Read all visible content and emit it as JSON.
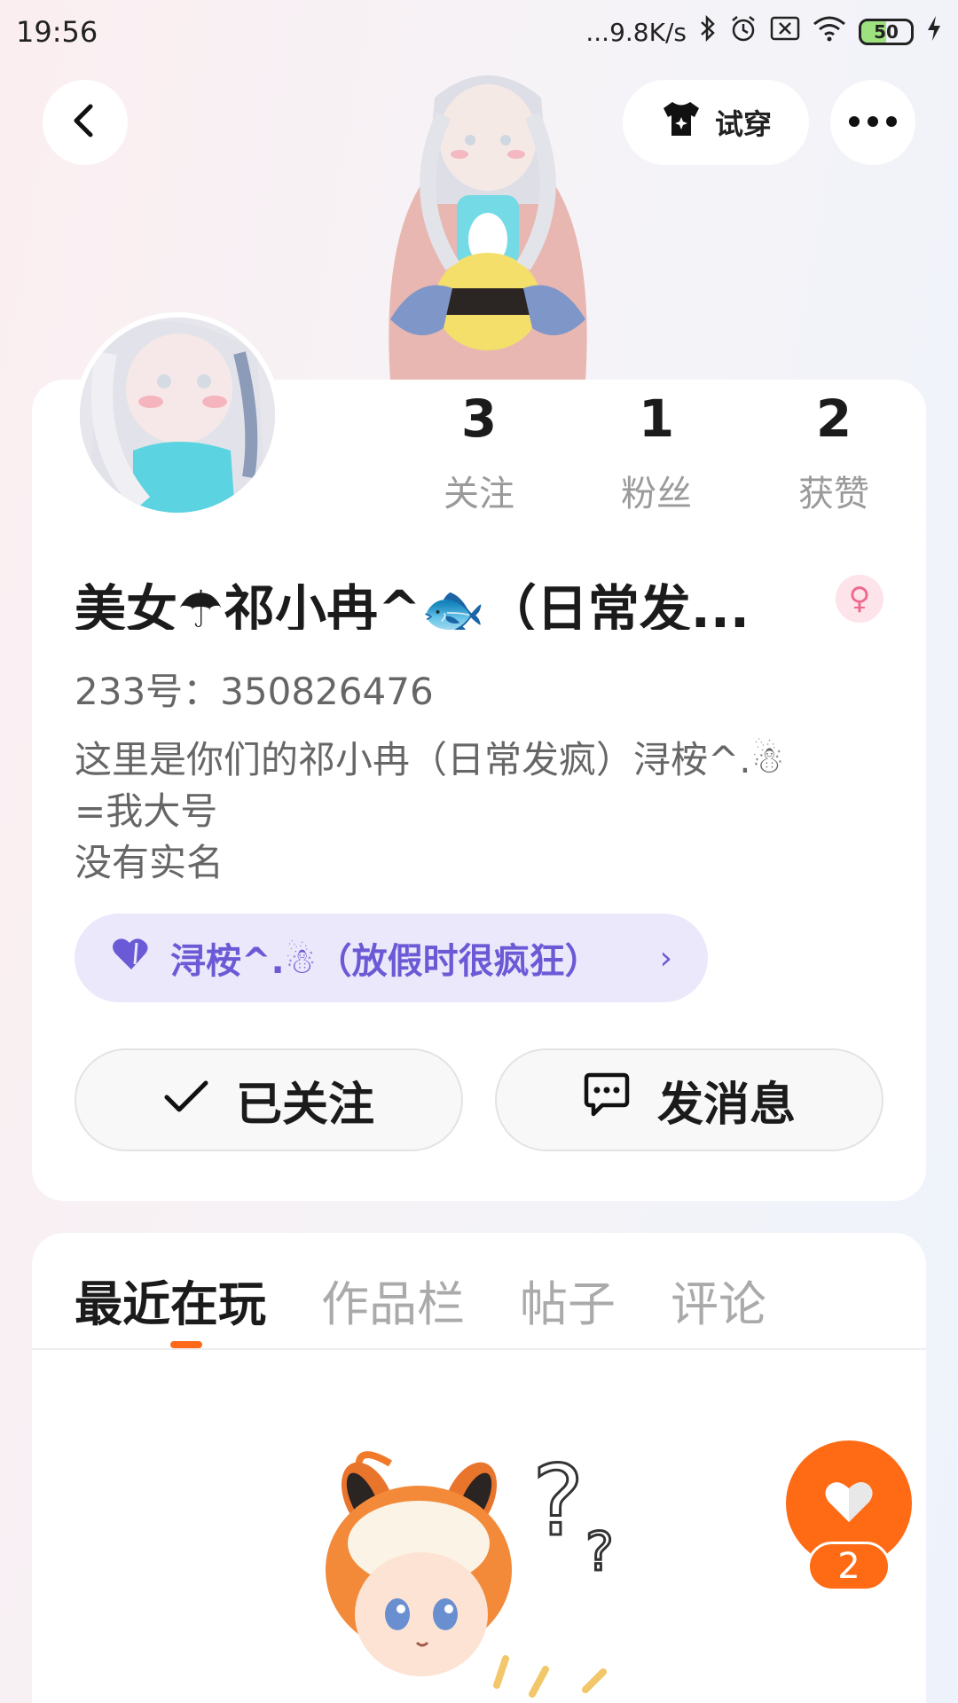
{
  "status_bar": {
    "time": "19:56",
    "network_speed": "...9.8K/s",
    "battery": "50",
    "icons": [
      "bluetooth-icon",
      "alarm-icon",
      "sim-off-icon",
      "wifi-icon",
      "battery-icon",
      "charging-icon"
    ]
  },
  "header": {
    "tryon_label": "试穿",
    "icons": [
      "back-icon",
      "shirt-icon",
      "more-icon"
    ]
  },
  "profile": {
    "stats": [
      {
        "value": "3",
        "label": "关注"
      },
      {
        "value": "1",
        "label": "粉丝"
      },
      {
        "value": "2",
        "label": "获赞"
      }
    ],
    "nickname": "美女☂祁小冉^🐟（日常发...",
    "gender_symbol": "♀",
    "uid": "233号：350826476",
    "bio": "这里是你们的祁小冉（日常发疯）浔桉^.☃\n=我大号\n没有实名",
    "group": {
      "label": "浔桉^.☃（放假时很疯狂）",
      "chevron": "›"
    },
    "follow_label": "已关注",
    "message_label": "发消息"
  },
  "tabs": {
    "items": [
      "最近在玩",
      "作品栏",
      "帖子",
      "评论"
    ],
    "active": 0
  },
  "like": {
    "count": "2"
  },
  "colors": {
    "accent": "#ff6a14",
    "group_pill_bg": "#ebe8fb",
    "group_pill_text": "#6b5ad6",
    "gender_bg": "#fde4ea"
  }
}
